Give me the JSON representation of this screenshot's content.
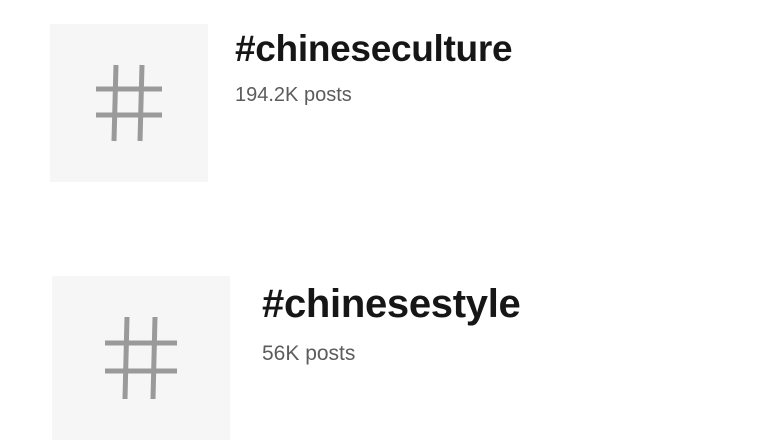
{
  "hashtags": [
    {
      "tag": "#chineseculture",
      "count": "194.2K posts",
      "icon": "hash-icon"
    },
    {
      "tag": "#chinesestyle",
      "count": "56K posts",
      "icon": "hash-icon"
    }
  ],
  "colors": {
    "thumbnail_bg": "#f6f6f6",
    "hash_glyph": "#9a9a9a",
    "title_text": "#161616",
    "count_text": "#5c5c5c"
  }
}
